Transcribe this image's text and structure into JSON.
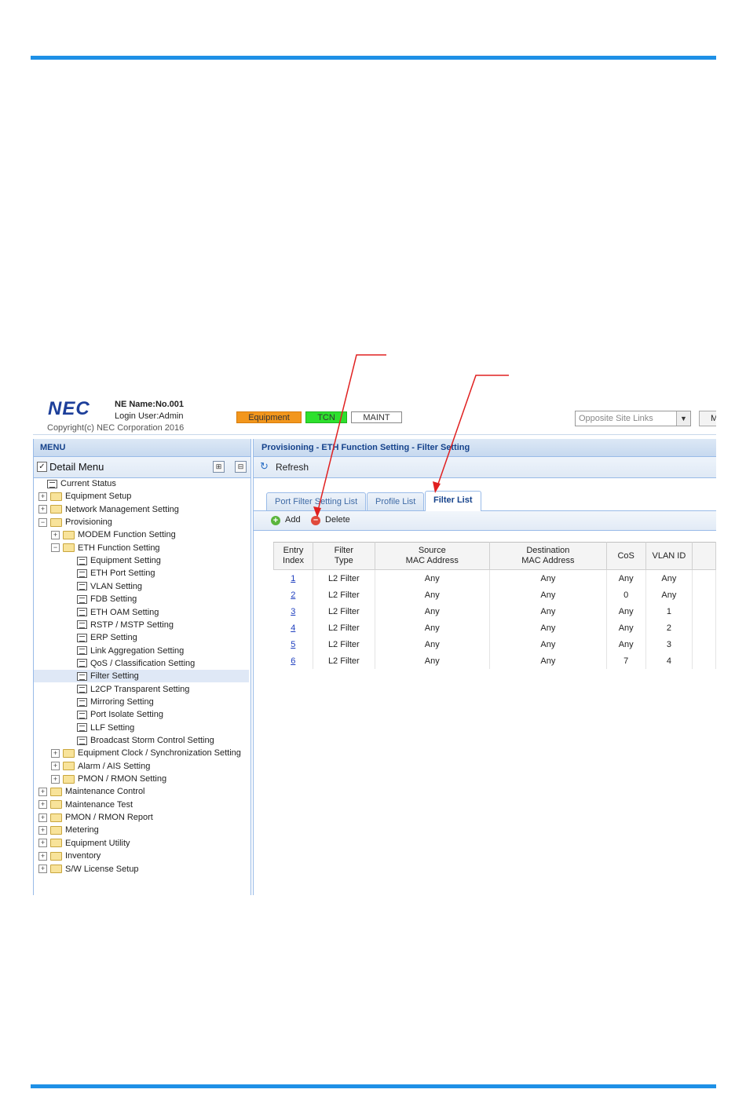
{
  "header": {
    "logo": "NEC",
    "ne_name": "NE Name:No.001",
    "login_user": "Login User:Admin",
    "copyright": "Copyright(c) NEC Corporation 2016",
    "status": {
      "equipment": "Equipment",
      "tcn": "TCN",
      "maint": "MAINT"
    },
    "opposite_site_links": "Opposite Site Links",
    "extra_button": "M"
  },
  "colors": {
    "accent_rule": "#1e90e6",
    "equipment_status": "#f2961c",
    "tcn_status": "#2de02d",
    "annotation_arrow": "#e02020"
  },
  "menu": {
    "title": "MENU",
    "detail_menu_label": "Detail Menu",
    "detail_menu_checked": true,
    "tree": [
      {
        "label": "Current Status",
        "type": "doc",
        "level": 0
      },
      {
        "label": "Equipment Setup",
        "type": "folder",
        "level": 0,
        "expanded": false
      },
      {
        "label": "Network Management Setting",
        "type": "folder",
        "level": 0,
        "expanded": false
      },
      {
        "label": "Provisioning",
        "type": "folder",
        "level": 0,
        "expanded": true
      },
      {
        "label": "MODEM Function Setting",
        "type": "folder",
        "level": 1,
        "expanded": false
      },
      {
        "label": "ETH Function Setting",
        "type": "folder",
        "level": 1,
        "expanded": true
      },
      {
        "label": "Equipment Setting",
        "type": "doc",
        "level": 2
      },
      {
        "label": "ETH Port Setting",
        "type": "doc",
        "level": 2
      },
      {
        "label": "VLAN Setting",
        "type": "doc",
        "level": 2
      },
      {
        "label": "FDB Setting",
        "type": "doc",
        "level": 2
      },
      {
        "label": "ETH OAM Setting",
        "type": "doc",
        "level": 2
      },
      {
        "label": "RSTP / MSTP Setting",
        "type": "doc",
        "level": 2
      },
      {
        "label": "ERP Setting",
        "type": "doc",
        "level": 2
      },
      {
        "label": "Link Aggregation Setting",
        "type": "doc",
        "level": 2
      },
      {
        "label": "QoS / Classification Setting",
        "type": "doc",
        "level": 2
      },
      {
        "label": "Filter Setting",
        "type": "doc",
        "level": 2,
        "selected": true
      },
      {
        "label": "L2CP Transparent Setting",
        "type": "doc",
        "level": 2
      },
      {
        "label": "Mirroring Setting",
        "type": "doc",
        "level": 2
      },
      {
        "label": "Port Isolate Setting",
        "type": "doc",
        "level": 2
      },
      {
        "label": "LLF Setting",
        "type": "doc",
        "level": 2
      },
      {
        "label": "Broadcast Storm Control Setting",
        "type": "doc",
        "level": 2
      },
      {
        "label": "Equipment Clock / Synchronization Setting",
        "type": "folder",
        "level": 1,
        "expanded": false
      },
      {
        "label": "Alarm / AIS Setting",
        "type": "folder",
        "level": 1,
        "expanded": false
      },
      {
        "label": "PMON / RMON Setting",
        "type": "folder",
        "level": 1,
        "expanded": false
      },
      {
        "label": "Maintenance Control",
        "type": "folder",
        "level": 0,
        "expanded": false
      },
      {
        "label": "Maintenance Test",
        "type": "folder",
        "level": 0,
        "expanded": false
      },
      {
        "label": "PMON / RMON Report",
        "type": "folder",
        "level": 0,
        "expanded": false
      },
      {
        "label": "Metering",
        "type": "folder",
        "level": 0,
        "expanded": false
      },
      {
        "label": "Equipment Utility",
        "type": "folder",
        "level": 0,
        "expanded": false
      },
      {
        "label": "Inventory",
        "type": "folder",
        "level": 0,
        "expanded": false
      },
      {
        "label": "S/W License Setup",
        "type": "folder",
        "level": 0,
        "expanded": false
      }
    ]
  },
  "content": {
    "breadcrumb": "Provisioning - ETH Function Setting - Filter Setting",
    "refresh_label": "Refresh",
    "tabs": [
      {
        "label": "Port Filter Setting List",
        "active": false
      },
      {
        "label": "Profile List",
        "active": false
      },
      {
        "label": "Filter List",
        "active": true
      }
    ],
    "add_label": "Add",
    "delete_label": "Delete",
    "table": {
      "headers": [
        [
          "Entry",
          "Index"
        ],
        [
          "Filter",
          "Type"
        ],
        [
          "Source",
          "MAC Address"
        ],
        [
          "Destination",
          "MAC Address"
        ],
        [
          "CoS"
        ],
        [
          "VLAN ID"
        ],
        [
          ""
        ]
      ],
      "rows": [
        [
          "1",
          "L2 Filter",
          "Any",
          "Any",
          "Any",
          "Any"
        ],
        [
          "2",
          "L2 Filter",
          "Any",
          "Any",
          "0",
          "Any"
        ],
        [
          "3",
          "L2 Filter",
          "Any",
          "Any",
          "Any",
          "1"
        ],
        [
          "4",
          "L2 Filter",
          "Any",
          "Any",
          "Any",
          "2"
        ],
        [
          "5",
          "L2 Filter",
          "Any",
          "Any",
          "Any",
          "3"
        ],
        [
          "6",
          "L2 Filter",
          "Any",
          "Any",
          "7",
          "4"
        ]
      ]
    }
  }
}
